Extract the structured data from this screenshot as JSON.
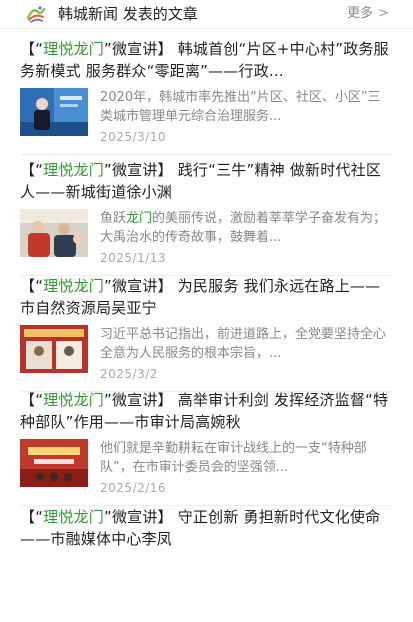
{
  "header": {
    "title": "韩城新闻 发表的文章",
    "more_label": "更多",
    "more_icon": "chevron-right-icon",
    "logo_icon": "city-logo-icon"
  },
  "articles": [
    {
      "title_open": "【“",
      "title_highlight": "理悦龙门",
      "title_rest": "”微宣讲】 韩城首创“片区+中心村”政务服务新模式 服务群众“零距离”——行政...",
      "summary_pre": "2020年，韩城市率先推出“片区、社区、小区”三类城市管理单元综合治理服务...",
      "summary_highlight": "",
      "summary_post": "",
      "date": "2025/3/10"
    },
    {
      "title_open": "【“",
      "title_highlight": "理悦龙门",
      "title_rest": "”微宣讲】 践行“三牛”精神 做新时代社区人——新城街道徐小渊",
      "summary_pre": "鱼跃",
      "summary_highlight": "龙门",
      "summary_post": "的美丽传说，激励着莘莘学子奋发有为；大禹治水的传奇故事，鼓舞着...",
      "date": "2025/1/13"
    },
    {
      "title_open": "【“",
      "title_highlight": "理悦龙门",
      "title_rest": "”微宣讲】 为民服务 我们永远在路上——市自然资源局吴亚宁",
      "summary_pre": "习近平总书记指出，前进道路上，全党要坚持全心全意为人民服务的根本宗旨，...",
      "summary_highlight": "",
      "summary_post": "",
      "date": "2025/3/2"
    },
    {
      "title_open": "【“",
      "title_highlight": "理悦龙门",
      "title_rest": "”微宣讲】 高举审计利剑 发挥经济监督“特种部队”作用——市审计局高婉秋",
      "summary_pre": "他们就是辛勤耕耘在审计战线上的一支“特种部队”，在市审计委员会的坚强领...",
      "summary_highlight": "",
      "summary_post": "",
      "date": "2025/2/16"
    },
    {
      "title_open": "【“",
      "title_highlight": "理悦龙门",
      "title_rest": "”微宣讲】 守正创新 勇担新时代文化使命——市融媒体中心李凤",
      "summary_pre": "",
      "summary_highlight": "",
      "summary_post": "",
      "date": ""
    }
  ],
  "colors": {
    "highlight": "#2e9b2e",
    "summary": "#888888",
    "date": "#aaaaaa"
  }
}
